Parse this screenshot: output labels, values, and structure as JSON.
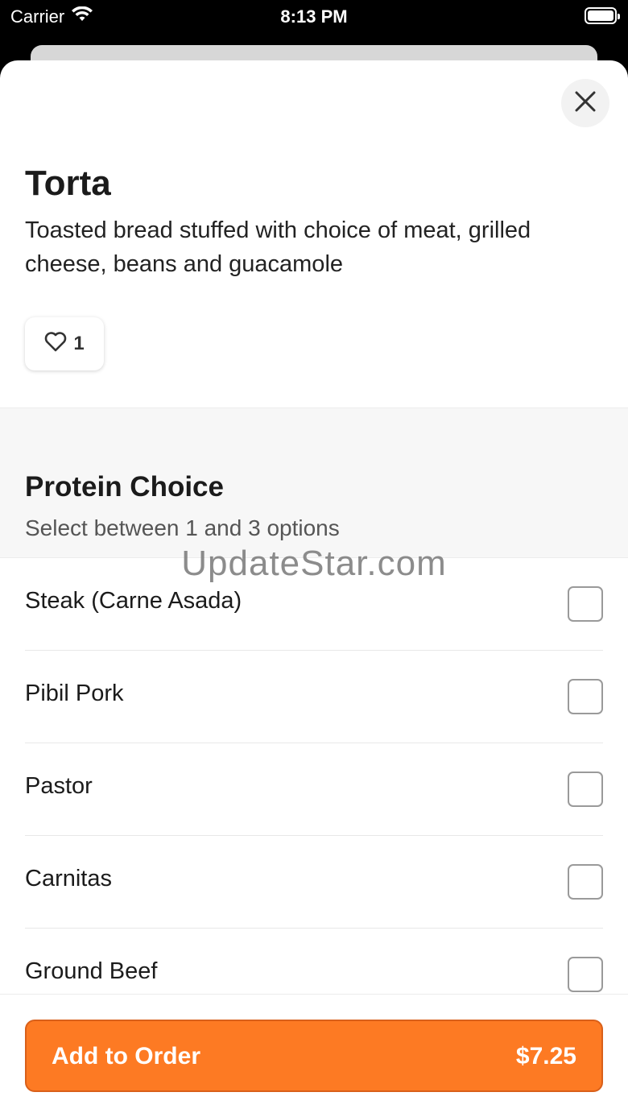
{
  "status_bar": {
    "carrier": "Carrier",
    "time": "8:13 PM"
  },
  "item": {
    "title": "Torta",
    "description": "Toasted bread stuffed with choice of meat, grilled cheese, beans and guacamole",
    "likes": "1"
  },
  "section": {
    "title": "Protein Choice",
    "subtitle": "Select between 1 and 3 options"
  },
  "options": [
    {
      "label": "Steak (Carne Asada)",
      "checked": false
    },
    {
      "label": "Pibil Pork",
      "checked": false
    },
    {
      "label": "Pastor",
      "checked": false
    },
    {
      "label": "Carnitas",
      "checked": false
    },
    {
      "label": "Ground Beef",
      "checked": false
    }
  ],
  "footer": {
    "button_label": "Add to Order",
    "price": "$7.25"
  },
  "watermark": "UpdateStar.com",
  "colors": {
    "accent": "#fd7a23"
  },
  "icons": {
    "close": "close-icon",
    "like": "heart-icon",
    "wifi": "wifi-icon",
    "battery": "battery-icon"
  }
}
